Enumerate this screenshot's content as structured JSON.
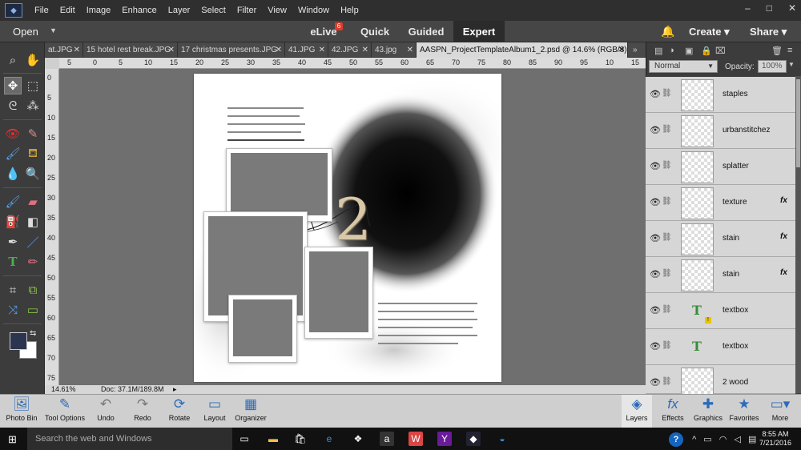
{
  "menu": {
    "items": [
      "File",
      "Edit",
      "Image",
      "Enhance",
      "Layer",
      "Select",
      "Filter",
      "View",
      "Window",
      "Help"
    ],
    "window_controls": [
      "–",
      "□",
      "✕"
    ]
  },
  "modebar": {
    "open_label": "Open",
    "modes": [
      "eLive",
      "Quick",
      "Guided",
      "Expert"
    ],
    "active_mode": "Expert",
    "elive_badge": "6",
    "create_label": "Create",
    "share_label": "Share"
  },
  "tabs": [
    {
      "label": "at.JPG"
    },
    {
      "label": "15 hotel rest break.JPG"
    },
    {
      "label": "17 christmas presents.JPG"
    },
    {
      "label": "41.JPG"
    },
    {
      "label": "42.JPG"
    },
    {
      "label": "43.jpg"
    },
    {
      "label": "AASPN_ProjectTemplateAlbum1_2.psd @ 14.6% (RGB/8)",
      "active": true
    }
  ],
  "tabs_more": "»",
  "ruler": {
    "h": [
      "5",
      "0",
      "5",
      "10",
      "15",
      "20",
      "25",
      "30",
      "35",
      "40",
      "45",
      "50",
      "55",
      "60",
      "65",
      "70",
      "75",
      "80",
      "85",
      "90",
      "95",
      "10",
      "15"
    ],
    "v": [
      "0",
      "5",
      "10",
      "15",
      "20",
      "25",
      "30",
      "35",
      "40",
      "45",
      "50",
      "55",
      "60",
      "65",
      "70",
      "75"
    ]
  },
  "status": {
    "zoom": "14.61%",
    "doc": "Doc: 37.1M/189.8M"
  },
  "layers_panel": {
    "blend_mode": "Normal",
    "opacity_label": "Opacity:",
    "opacity_value": "100%",
    "layers": [
      {
        "name": "staples",
        "type": "pixel",
        "fx": false
      },
      {
        "name": "urbanstitchez",
        "type": "pixel",
        "fx": false
      },
      {
        "name": "splatter",
        "type": "pixel",
        "fx": false
      },
      {
        "name": "texture",
        "type": "pixel",
        "fx": true
      },
      {
        "name": "stain",
        "type": "pixel",
        "fx": true
      },
      {
        "name": "stain",
        "type": "pixel",
        "fx": true
      },
      {
        "name": "textbox",
        "type": "text",
        "fx": false,
        "warning": true
      },
      {
        "name": "textbox",
        "type": "text",
        "fx": false
      },
      {
        "name": "2 wood",
        "type": "pixel",
        "fx": false
      }
    ],
    "fx_label": "fx",
    "text_thumb": "T"
  },
  "canvas_number": "2",
  "bottom_bar": {
    "left": [
      {
        "label": "Photo Bin",
        "icon": "photo-bin-icon"
      },
      {
        "label": "Tool Options",
        "icon": "tool-options-icon"
      },
      {
        "label": "Undo",
        "icon": "undo-icon"
      },
      {
        "label": "Redo",
        "icon": "redo-icon"
      },
      {
        "label": "Rotate",
        "icon": "rotate-icon"
      },
      {
        "label": "Layout",
        "icon": "layout-icon"
      },
      {
        "label": "Organizer",
        "icon": "organizer-icon"
      }
    ],
    "right": [
      {
        "label": "Layers",
        "icon": "layers-icon"
      },
      {
        "label": "Effects",
        "icon": "effects-icon"
      },
      {
        "label": "Graphics",
        "icon": "graphics-icon"
      },
      {
        "label": "Favorites",
        "icon": "favorites-icon"
      },
      {
        "label": "More",
        "icon": "more-icon"
      }
    ]
  },
  "taskbar": {
    "search_placeholder": "Search the web and Windows",
    "time": "8:55 AM",
    "date": "7/21/2016"
  }
}
